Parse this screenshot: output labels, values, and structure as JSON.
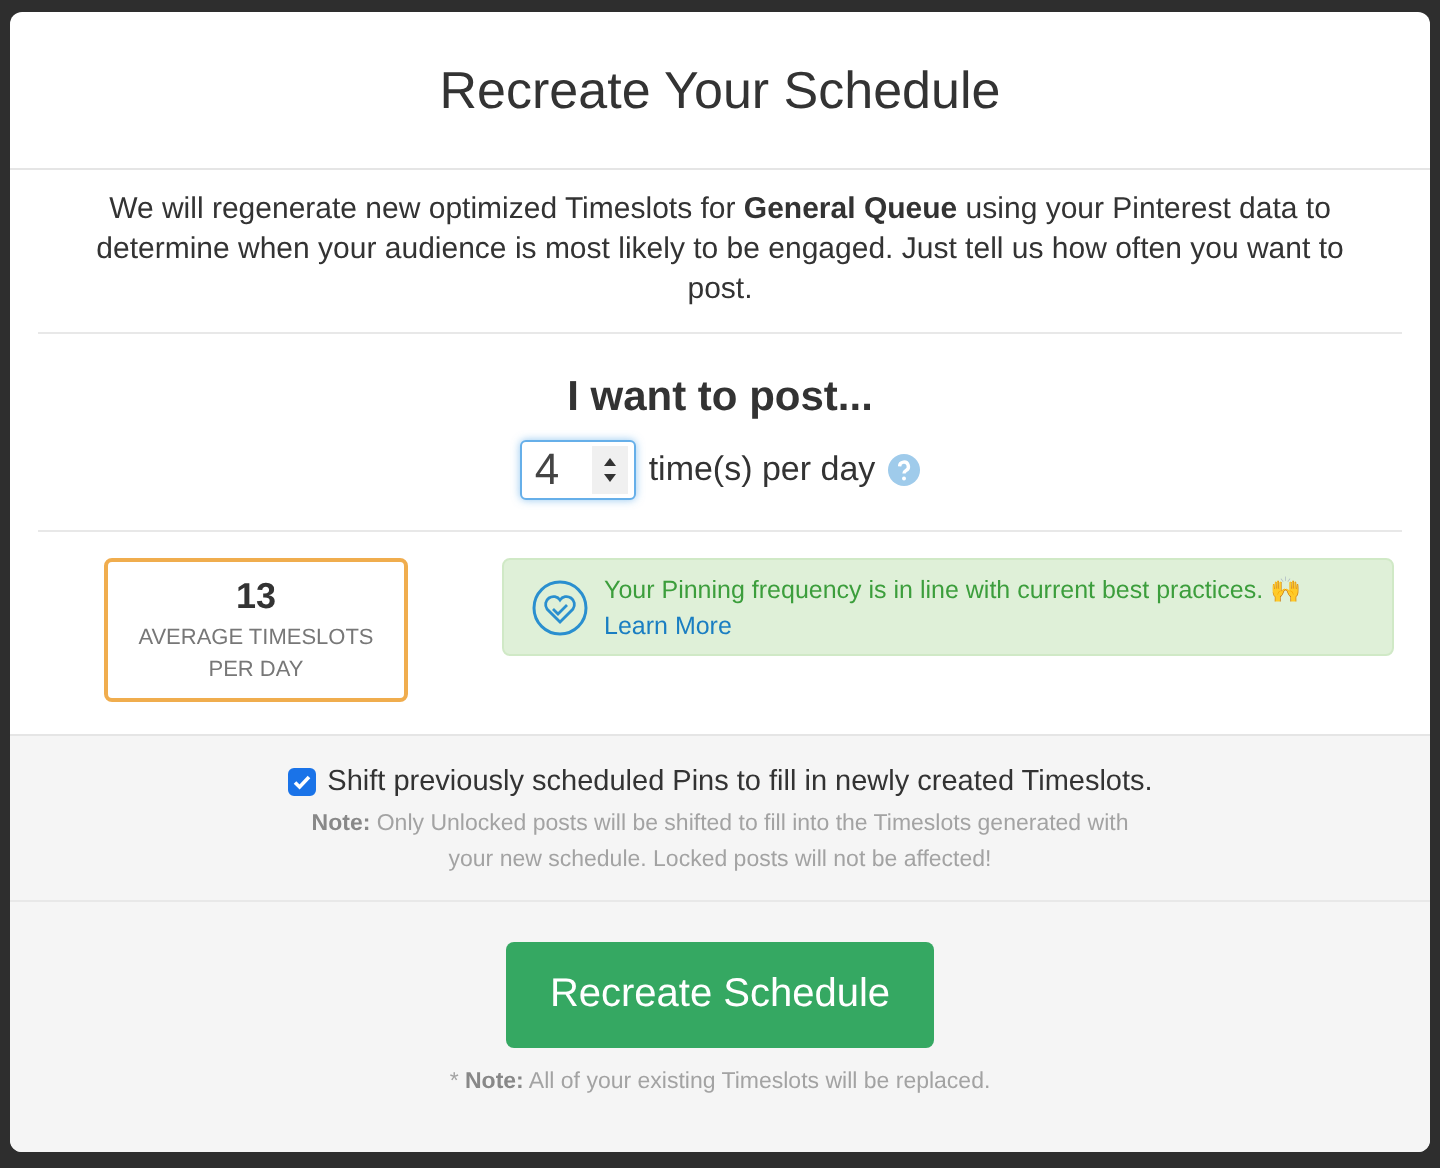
{
  "dialog": {
    "title": "Recreate Your Schedule",
    "description": "We will regenerate new optimized Timeslots for **General Queue** using your Pinterest data to determine when your audience is most likely to be engaged. Just tell us how often you want to post."
  },
  "frequency": {
    "heading": "I want to post...",
    "value": "4",
    "unit": "time(s) per day"
  },
  "stat": {
    "value": "13",
    "label": "AVERAGE TIMESLOTS PER DAY"
  },
  "alert": {
    "message": "Your Pinning frequency is in line with current best practices. 🙌",
    "link": "Learn More"
  },
  "shift_option": {
    "label": "Shift previously scheduled Pins to fill in newly created Timeslots.",
    "checked": true,
    "note": "**Note:** Only Unlocked posts will be shifted to fill into the Timeslots generated with your new schedule. Locked posts will not be affected!"
  },
  "submit_button": "Recreate Schedule",
  "footer_note": "* **Note:** All of your existing Timeslots will be replaced."
}
